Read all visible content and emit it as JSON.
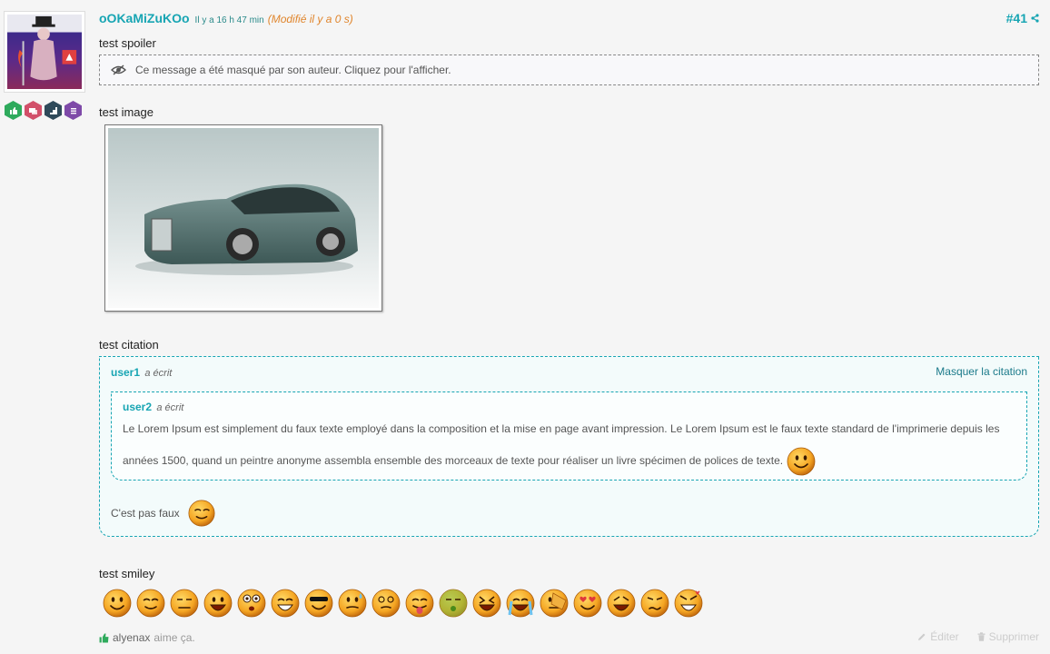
{
  "post": {
    "author": "oOKaMiZuKOo",
    "time": "Il y a 16 h 47 min",
    "modified": "(Modifié il y a 0 s)",
    "number": "#41"
  },
  "labels": {
    "spoiler": "test spoiler",
    "image": "test image",
    "quote": "test citation",
    "smiley": "test smiley"
  },
  "spoiler": {
    "text": "Ce message a été masqué par son auteur. Cliquez pour l'afficher."
  },
  "quote": {
    "user": "user1",
    "wrote": "a écrit",
    "hide_label": "Masquer la citation",
    "nested_user": "user2",
    "nested_wrote": "a écrit",
    "nested_text": "Le Lorem Ipsum est simplement du faux texte employé dans la composition et la mise en page avant impression. Le Lorem Ipsum est le faux texte standard de l'imprimerie depuis les années 1500, quand un peintre anonyme assembla ensemble des morceaux de texte pour réaliser un livre spécimen de polices de texte.",
    "reply": "C'est pas faux"
  },
  "likes": {
    "user": "alyenax",
    "text": "aime ça."
  },
  "actions": {
    "edit": "Éditer",
    "delete": "Supprimer"
  },
  "colors": {
    "accent": "#17a5b3",
    "modified": "#e0852c",
    "badge_green": "#2eaa5c",
    "badge_red": "#d2506a",
    "badge_dark": "#2f4a5a",
    "badge_purple": "#7e4aa8"
  },
  "icons": {
    "badges": [
      "thumbs-up-icon",
      "chat-icon",
      "stairs-icon",
      "list-icon"
    ],
    "spoiler": "eye-slash-icon",
    "share": "share-icon",
    "like": "thumbs-up-icon",
    "edit": "pencil-icon",
    "delete": "trash-icon"
  },
  "smileys": [
    "smile",
    "wink",
    "squint",
    "grin",
    "surprised",
    "laugh",
    "cool",
    "sweat",
    "dizzy",
    "tongue",
    "sick",
    "xd",
    "cry",
    "facepalm",
    "love",
    "rofl",
    "confused",
    "angry"
  ]
}
